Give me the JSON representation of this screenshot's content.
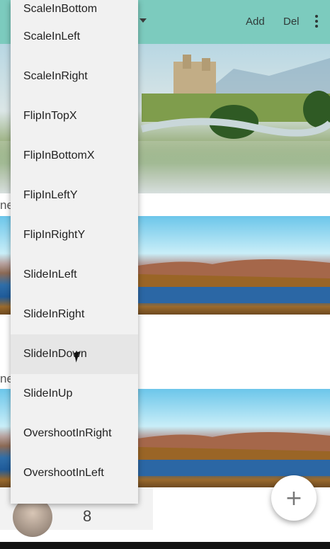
{
  "toolbar": {
    "add_label": "Add",
    "del_label": "Del",
    "bg_color": "#7ccbbe"
  },
  "feed": {
    "cut_text_1": "ne",
    "cut_text_2": "ne",
    "count": "8"
  },
  "menu": {
    "items": [
      "ScaleInBottom",
      "ScaleInLeft",
      "ScaleInRight",
      "FlipInTopX",
      "FlipInBottomX",
      "FlipInLeftY",
      "FlipInRightY",
      "SlideInLeft",
      "SlideInRight",
      "SlideInDown",
      "SlideInUp",
      "OvershootInRight",
      "OvershootInLeft"
    ],
    "hovered": "SlideInDown"
  },
  "fab": {
    "icon": "plus-icon",
    "label": "+"
  }
}
